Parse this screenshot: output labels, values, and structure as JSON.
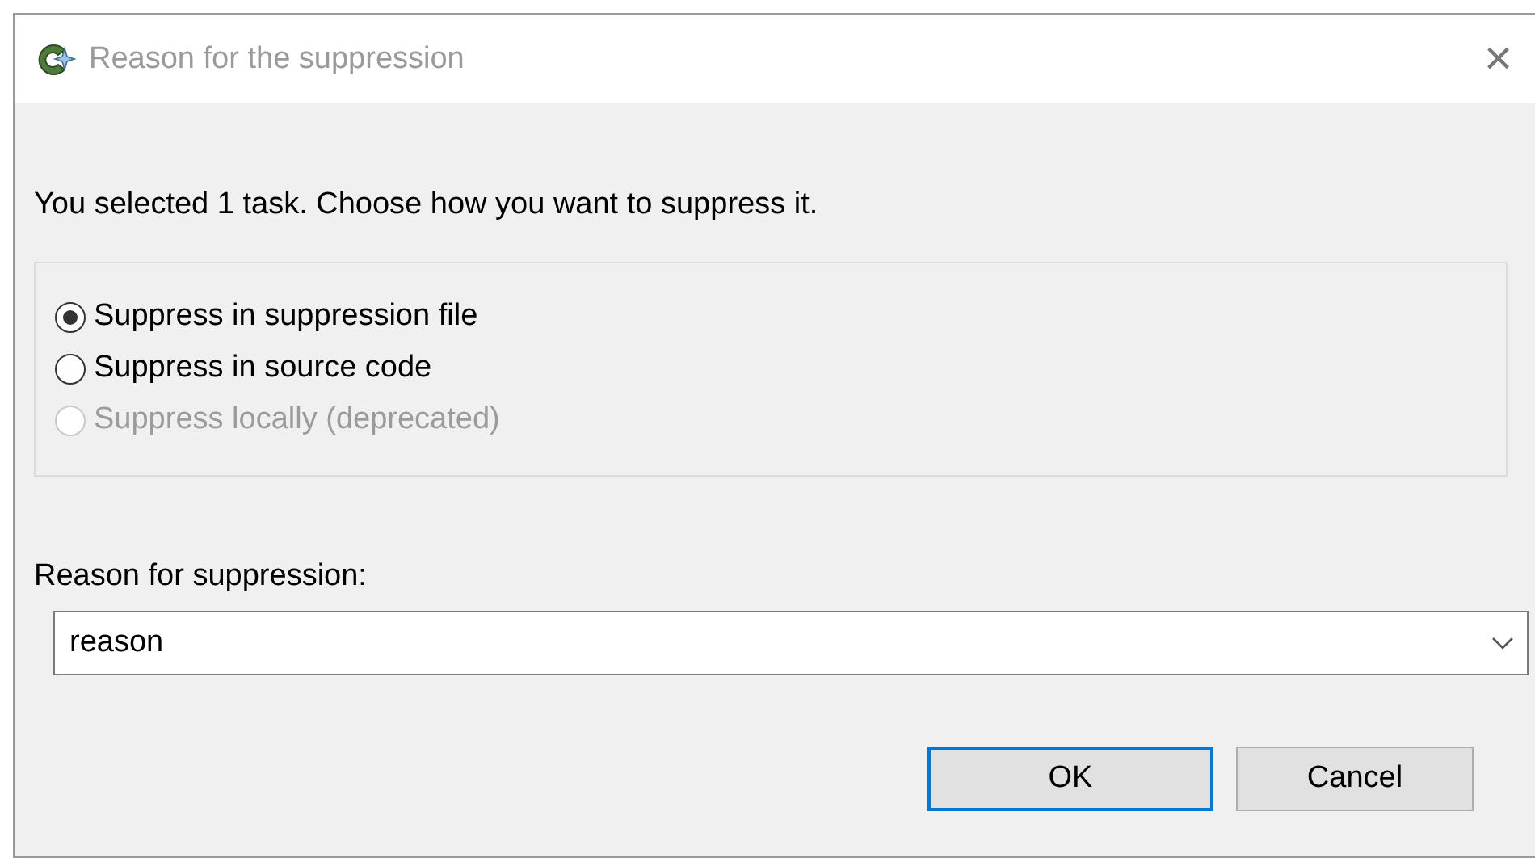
{
  "window": {
    "title": "Reason for the suppression",
    "close": "×"
  },
  "message": "You selected 1 task. Choose how you want to suppress it.",
  "options": [
    {
      "label": "Suppress in suppression file",
      "selected": true,
      "disabled": false
    },
    {
      "label": "Suppress in source code",
      "selected": false,
      "disabled": false
    },
    {
      "label": "Suppress locally (deprecated)",
      "selected": false,
      "disabled": true
    }
  ],
  "reason": {
    "label": "Reason for suppression:",
    "value": "reason"
  },
  "buttons": [
    {
      "label": "OK",
      "default": true
    },
    {
      "label": "Cancel",
      "default": false
    }
  ]
}
